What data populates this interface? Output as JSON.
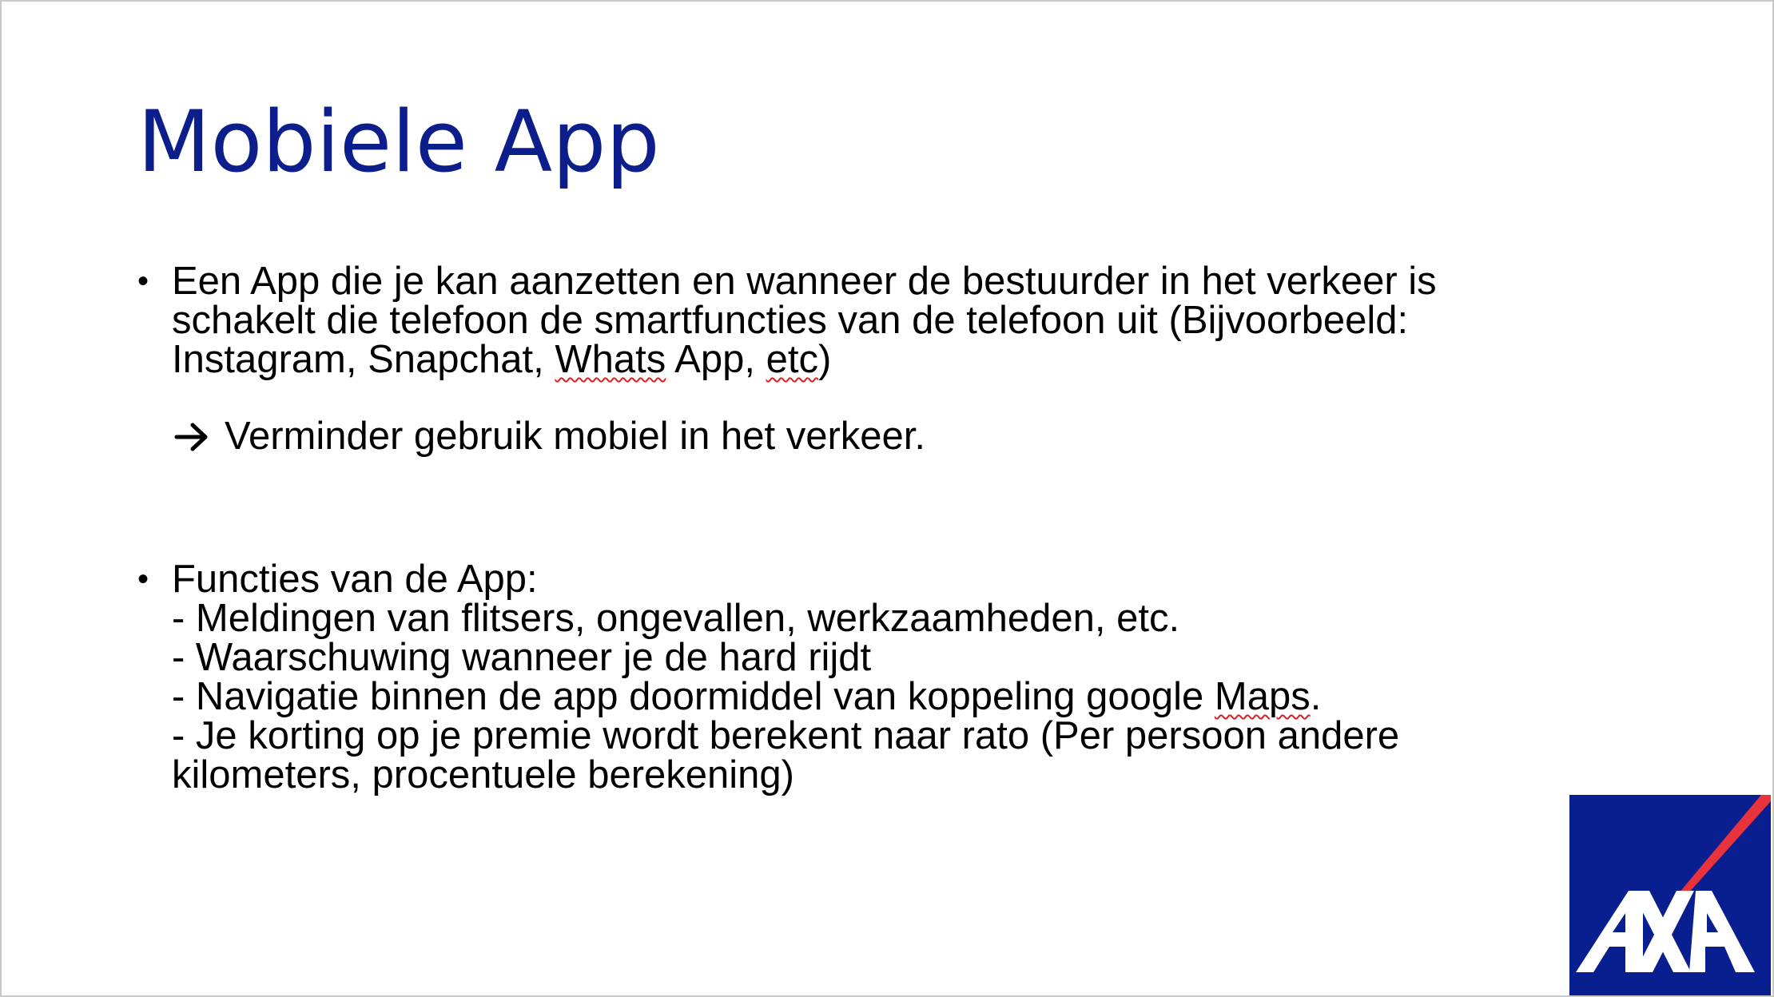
{
  "slide": {
    "title": "Mobiele App",
    "bullets": [
      {
        "bullet_symbol": "•",
        "lines": [
          "Een App die je kan aanzetten en wanneer de bestuurder in het verkeer is",
          "schakelt die telefoon de smartfuncties van de telefoon uit  (Bijvoorbeeld:"
        ],
        "line3_before": "Instagram, Snapchat, ",
        "line3_spell1": "Whats",
        "line3_middle": " App, ",
        "line3_spell2": "etc",
        "line3_after": ")",
        "arrow_icon": "right-arrow-icon",
        "arrow_text": "Verminder gebruik mobiel in het verkeer."
      },
      {
        "bullet_symbol": "•",
        "lines": [
          "Functies van de App:",
          "- Meldingen van flitsers, ongevallen, werkzaamheden, etc.",
          "- Waarschuwing wanneer je de hard rijdt"
        ],
        "line4_before": "- Navigatie binnen de app doormiddel van koppeling google ",
        "line4_spell": "Maps",
        "line4_after": ".",
        "lines_after": [
          "- Je korting op je premie wordt berekent naar rato (Per persoon andere",
          "kilometers, procentuele berekening)"
        ]
      }
    ],
    "logo": {
      "text": "AXA",
      "icon": "axa-logo",
      "colors": {
        "background": "#0a1f8f",
        "slash": "#e8323c",
        "letters": "#ffffff"
      }
    },
    "colors": {
      "title": "#0c1e8c",
      "body": "#000000",
      "spellcheck": "#e02020"
    }
  }
}
